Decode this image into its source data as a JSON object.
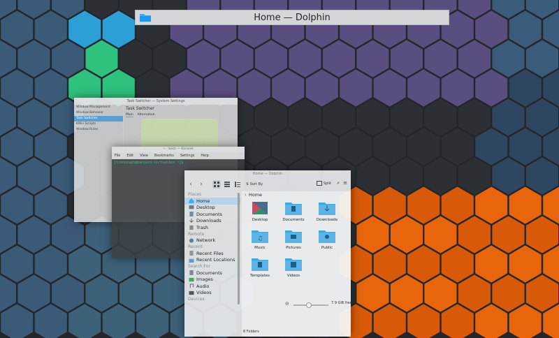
{
  "overlay_title": "Home — Dolphin",
  "colors": {
    "accent": "#3daee9",
    "folder": "#46a6d8",
    "orange": "#e8650c",
    "purple": "#5a4e80",
    "green": "#2ec27e"
  },
  "settings_window": {
    "title": "Task Switcher — System Settings",
    "sidebar": [
      "Window Management",
      "Window Behavior",
      "Task Switcher",
      "KWin Scripts",
      "Window Rules"
    ],
    "selected_index": 2,
    "page_title": "Task Switcher",
    "tabs": [
      "Main",
      "Alternative"
    ]
  },
  "konsole_window": {
    "title": "~ : bash — Konsole",
    "menu": [
      "File",
      "Edit",
      "View",
      "Bookmarks",
      "Settings",
      "Help"
    ],
    "prompt": "[trenozuph@manjaro-virtualbox ~]$"
  },
  "dolphin": {
    "title": "Home — Dolphin",
    "sort_label": "Sort By",
    "split_label": "Split",
    "breadcrumb": "Home",
    "places": [
      {
        "type": "header",
        "label": "Places"
      },
      {
        "type": "item",
        "icon": "home-icon",
        "label": "Home",
        "selected": true
      },
      {
        "type": "item",
        "icon": "desktop-icon",
        "label": "Desktop"
      },
      {
        "type": "item",
        "icon": "documents-icon",
        "label": "Documents"
      },
      {
        "type": "item",
        "icon": "downloads-icon",
        "label": "Downloads"
      },
      {
        "type": "item",
        "icon": "trash-icon",
        "label": "Trash"
      },
      {
        "type": "header",
        "label": "Remote"
      },
      {
        "type": "item",
        "icon": "network-icon",
        "label": "Network"
      },
      {
        "type": "header",
        "label": "Recent"
      },
      {
        "type": "item",
        "icon": "recent-files-icon",
        "label": "Recent Files"
      },
      {
        "type": "item",
        "icon": "recent-locations-icon",
        "label": "Recent Locations"
      },
      {
        "type": "header",
        "label": "Search For"
      },
      {
        "type": "item",
        "icon": "documents-icon",
        "label": "Documents"
      },
      {
        "type": "item",
        "icon": "images-icon",
        "label": "Images"
      },
      {
        "type": "item",
        "icon": "audio-icon",
        "label": "Audio"
      },
      {
        "type": "item",
        "icon": "videos-icon",
        "label": "Videos"
      },
      {
        "type": "header",
        "label": "Devices"
      }
    ],
    "files": [
      {
        "name": "Desktop",
        "icon": "desktop-folder-icon"
      },
      {
        "name": "Documents",
        "icon": "documents-folder-icon"
      },
      {
        "name": "Downloads",
        "icon": "downloads-folder-icon"
      },
      {
        "name": "Music",
        "icon": "music-folder-icon"
      },
      {
        "name": "Pictures",
        "icon": "pictures-folder-icon"
      },
      {
        "name": "Public",
        "icon": "public-folder-icon"
      },
      {
        "name": "Templates",
        "icon": "templates-folder-icon"
      },
      {
        "name": "Videos",
        "icon": "videos-folder-icon"
      }
    ],
    "status_text": "8 Folders",
    "free_space": "7.9 GiB free"
  }
}
